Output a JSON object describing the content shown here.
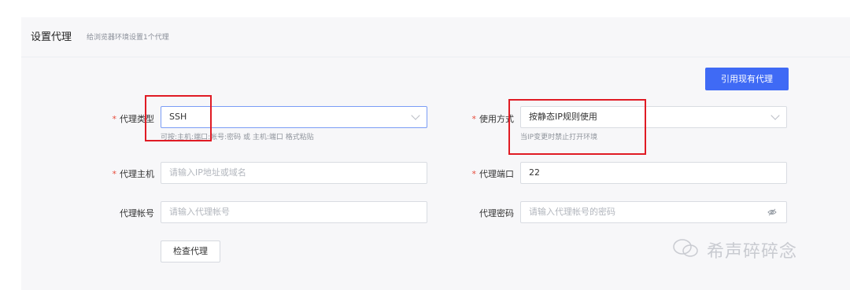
{
  "header": {
    "title": "设置代理",
    "subtitle": "给浏览器环境设置1个代理"
  },
  "actions": {
    "use_existing_proxy": "引用现有代理",
    "check_proxy": "检查代理"
  },
  "form": {
    "proxy_type": {
      "label": "代理类型",
      "value": "SSH",
      "hint": "可按:主机:端口:帐号:密码 或 主机:端口 格式粘贴"
    },
    "usage_mode": {
      "label": "使用方式",
      "value": "按静态IP规则使用",
      "hint": "当IP变更时禁止打开环境"
    },
    "proxy_host": {
      "label": "代理主机",
      "placeholder": "请输入IP地址或域名"
    },
    "proxy_port": {
      "label": "代理端口",
      "value": "22"
    },
    "proxy_account": {
      "label": "代理帐号",
      "placeholder": "请输入代理帐号"
    },
    "proxy_password": {
      "label": "代理密码",
      "placeholder": "请输入代理帐号的密码"
    }
  },
  "watermark": {
    "text": "希声碎碎念"
  },
  "colors": {
    "primary": "#3f6af5",
    "required": "#e74c3c",
    "highlight_box": "#e01b24"
  }
}
